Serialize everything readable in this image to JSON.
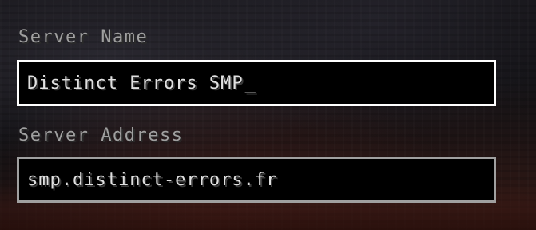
{
  "server_name": {
    "label": "Server Name",
    "value": "Distinct Errors SMP",
    "cursor": "_"
  },
  "server_address": {
    "label": "Server Address",
    "value": "smp.distinct-errors.fr"
  },
  "colors": {
    "label_text": "#a0a0a0",
    "field_text": "#e0e0e0",
    "focused_border": "#ffffff",
    "unfocused_border": "#a0a0a0",
    "field_background": "#000000"
  }
}
